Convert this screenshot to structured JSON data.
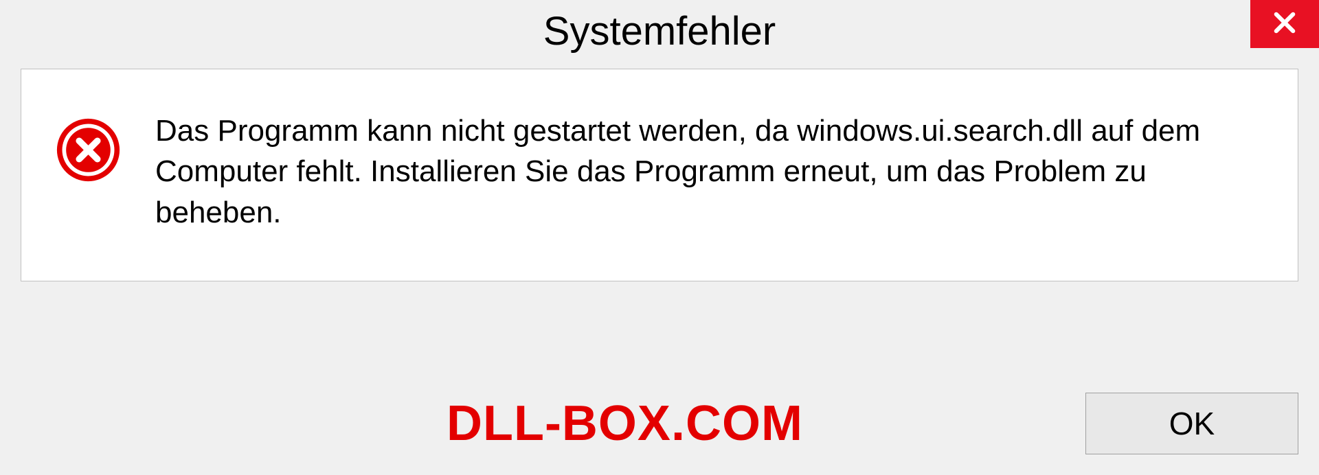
{
  "dialog": {
    "title": "Systemfehler",
    "message": "Das Programm kann nicht gestartet werden, da windows.ui.search.dll auf dem Computer fehlt. Installieren Sie das Programm erneut, um das Problem zu beheben.",
    "ok_label": "OK"
  },
  "watermark": "DLL-BOX.COM"
}
